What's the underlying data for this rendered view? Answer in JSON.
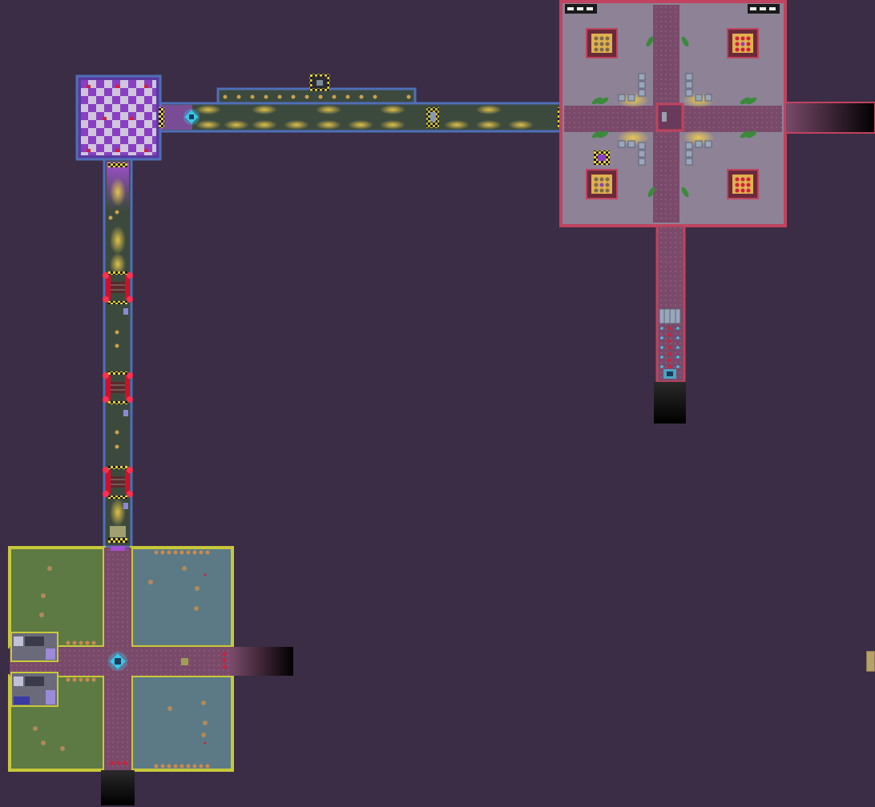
{
  "palette": {
    "background": "#3a2d45",
    "corridor_blue_wall": "#4f6fb8",
    "corridor_floor": "#3c4a3e",
    "light_glow": "#f2cf4a",
    "magenta_room_wall": "#c0435f",
    "magenta_room_floor": "#8d8296",
    "path_floor": "#7a4a6a",
    "yellow_wall": "#c8c83a",
    "green_floor": "#5d7a45",
    "teal_floor": "#5b7a86",
    "checker_purple": "#8a3fc2",
    "checker_light": "#cfc5dc",
    "red_gate": "#d0102a",
    "cyan_marker": "#38c7e8"
  },
  "icons": {
    "teleporter": "teleporter-icon",
    "gate": "security-gate-icon",
    "plant": "plant-icon",
    "crate": "crate-icon",
    "seat": "seat-icon",
    "locker": "locker-icon"
  }
}
